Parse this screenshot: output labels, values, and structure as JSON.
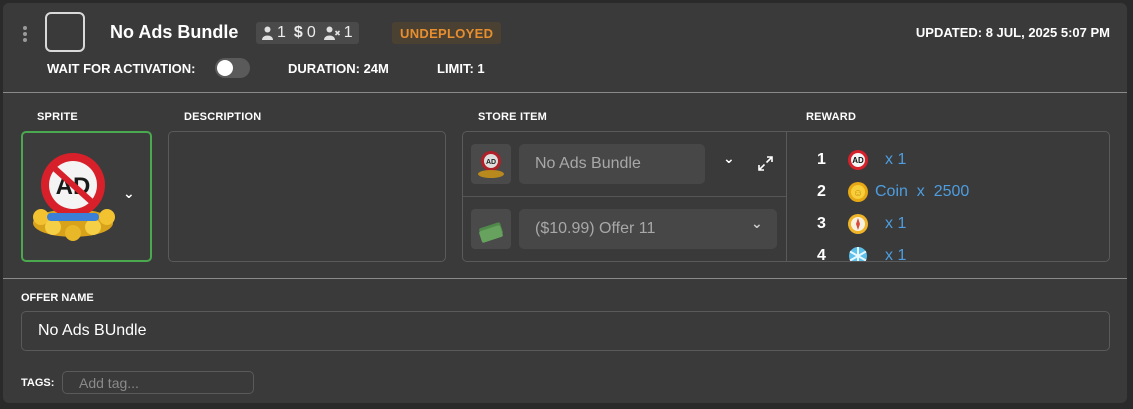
{
  "header": {
    "title": "No Ads Bundle",
    "stats": {
      "users": "1",
      "price": "0",
      "user_limit": "1"
    },
    "status_badge": "UNDEPLOYED",
    "updated": "UPDATED: 8 JUL, 2025 5:07 PM",
    "wait_for_activation_label": "WAIT FOR ACTIVATION:",
    "wait_for_activation_on": false,
    "duration": "DURATION: 24M",
    "limit": "LIMIT: 1"
  },
  "sections": {
    "sprite_label": "SPRITE",
    "description_label": "DESCRIPTION",
    "store_item_label": "STORE ITEM",
    "reward_label": "REWARD"
  },
  "store_item": {
    "item_name": "No Ads Bundle",
    "offer": "($10.99) Offer 11"
  },
  "rewards": [
    {
      "num": "1",
      "icon": "no-ads-icon",
      "text": "x 1"
    },
    {
      "num": "2",
      "icon": "coin-icon",
      "text": "Coin  x  2500"
    },
    {
      "num": "3",
      "icon": "compass-icon",
      "text": "x 1"
    },
    {
      "num": "4",
      "icon": "snowflake-icon",
      "text": "x 1"
    }
  ],
  "offer_name": {
    "label": "OFFER NAME",
    "value": "No Ads BUndle"
  },
  "tags": {
    "label": "TAGS:",
    "placeholder": "Add tag..."
  },
  "colors": {
    "card_bg": "#3a3a3a",
    "accent_green": "#4aa84f",
    "badge_orange": "#e88e2e",
    "link_blue": "#4d9de0"
  }
}
